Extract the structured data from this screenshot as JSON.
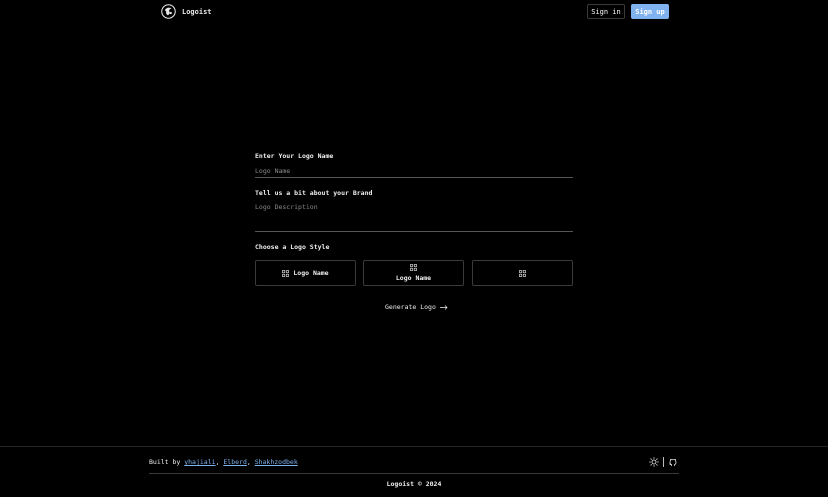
{
  "header": {
    "brand_name": "Logoist",
    "signin_label": "Sign in",
    "signup_label": "Sign up"
  },
  "form": {
    "name_label": "Enter Your Logo Name",
    "name_placeholder": "Logo Name",
    "description_label": "Tell us a bit about your Brand",
    "description_placeholder": "Logo Description",
    "style_label": "Choose a Logo Style",
    "styles": [
      {
        "label": "Logo Name",
        "layout": "icon-left"
      },
      {
        "label": "Logo Name",
        "layout": "icon-top"
      },
      {
        "label": "",
        "layout": "icon-only"
      }
    ],
    "generate_label": "Generate Logo"
  },
  "footer": {
    "built_by_prefix": "Built by",
    "authors": [
      "yhajiali",
      "Elberd",
      "Shakhzodbek"
    ],
    "copyright": "Logoist © 2024"
  },
  "colors": {
    "background": "#000000",
    "accent": "#7fb2ee",
    "border": "#3a3a3a"
  },
  "icons": {
    "brand": "brand-logo-icon",
    "style": "grid-icon",
    "generate": "arrow-right-icon",
    "theme": "sun-icon",
    "repo": "github-icon"
  }
}
